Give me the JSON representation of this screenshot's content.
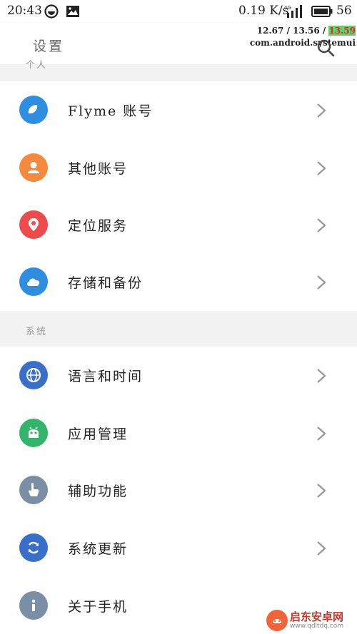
{
  "status_bar": {
    "time": "20:43",
    "speed": "0.19 K/s",
    "network": "4G",
    "battery": "56"
  },
  "header": {
    "title": "设置",
    "overlay_line1": "12.67 / 13.56 / ",
    "overlay_highlight": "13.59",
    "overlay_line2": "com.android.systemui"
  },
  "sections": {
    "personal_label": "个人",
    "system_label": "系统"
  },
  "personal_items": [
    {
      "label": "Flyme 账号",
      "icon": "flyme-icon",
      "color": "#2f8ee0"
    },
    {
      "label": "其他账号",
      "icon": "person-icon",
      "color": "#f38a3f"
    },
    {
      "label": "定位服务",
      "icon": "location-pin-icon",
      "color": "#ec4c4c"
    },
    {
      "label": "存储和备份",
      "icon": "cloud-icon",
      "color": "#2f8ee0"
    }
  ],
  "system_items": [
    {
      "label": "语言和时间",
      "icon": "globe-icon",
      "color": "#3a6fc9"
    },
    {
      "label": "应用管理",
      "icon": "android-icon",
      "color": "#34b36a"
    },
    {
      "label": "辅助功能",
      "icon": "hand-icon",
      "color": "#7a8fa6"
    },
    {
      "label": "系统更新",
      "icon": "refresh-icon",
      "color": "#3a6fc9"
    },
    {
      "label": "关于手机",
      "icon": "info-icon",
      "color": "#7a8fa6"
    }
  ],
  "watermark": {
    "text": "启东安卓网",
    "url": "www.qdltdq.com"
  }
}
